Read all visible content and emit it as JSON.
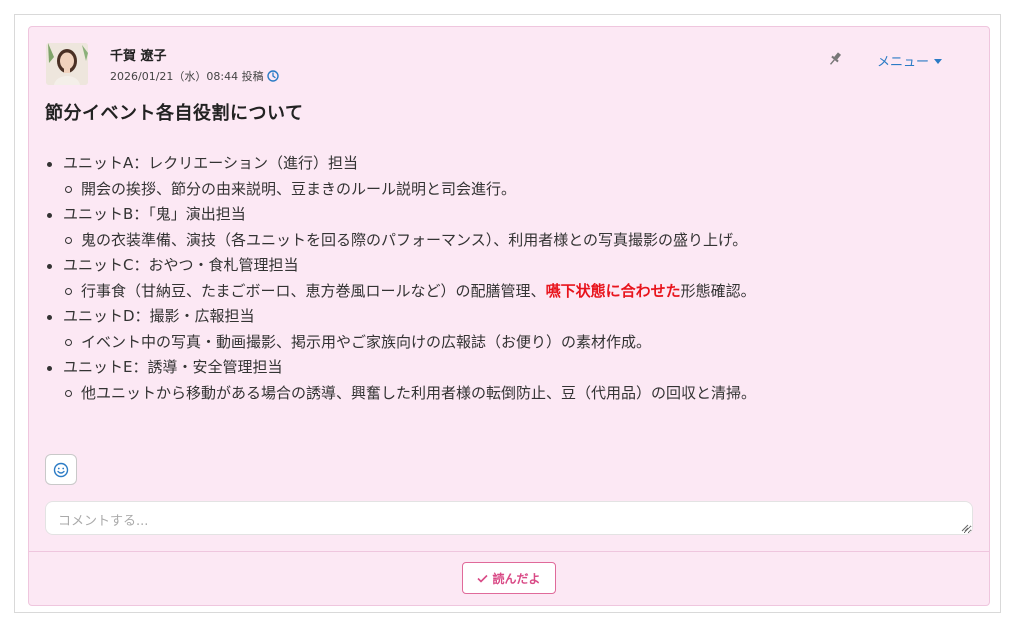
{
  "post": {
    "author": "千賀 遼子",
    "timestamp": "2026/01/21（水）08:44 投稿",
    "menu_label": "メニュー",
    "title": "節分イベント各自役割について",
    "items": [
      {
        "label": "ユニットA：レクリエーション（進行）担当",
        "detail": "開会の挨拶、節分の由来説明、豆まきのルール説明と司会進行。"
      },
      {
        "label": "ユニットB：「鬼」演出担当",
        "detail": "鬼の衣装準備、演技（各ユニットを回る際のパフォーマンス）、利用者様との写真撮影の盛り上げ。"
      },
      {
        "label": "ユニットC：おやつ・食札管理担当",
        "detail_before": "行事食（甘納豆、たまごボーロ、恵方巻風ロールなど）の配膳管理、",
        "detail_highlight": "嚥下状態に合わせた",
        "detail_after": "形態確認。"
      },
      {
        "label": "ユニットD：撮影・広報担当",
        "detail": "イベント中の写真・動画撮影、掲示用やご家族向けの広報誌（お便り）の素材作成。"
      },
      {
        "label": "ユニットE：誘導・安全管理担当",
        "detail": "他ユニットから移動がある場合の誘導、興奮した利用者様の転倒防止、豆（代用品）の回収と清掃。"
      }
    ]
  },
  "comment": {
    "placeholder": "コメントする..."
  },
  "read_button": {
    "label": "読んだよ"
  },
  "icons": {
    "pin": "pin-icon",
    "clock": "clock-icon",
    "caret": "caret-down-icon",
    "emoji": "smiley-icon",
    "check": "check-icon"
  },
  "colors": {
    "card_bg": "#fce8f4",
    "accent_link": "#2b7bc5",
    "highlight": "#e8141c",
    "read_button": "#d94a86"
  }
}
